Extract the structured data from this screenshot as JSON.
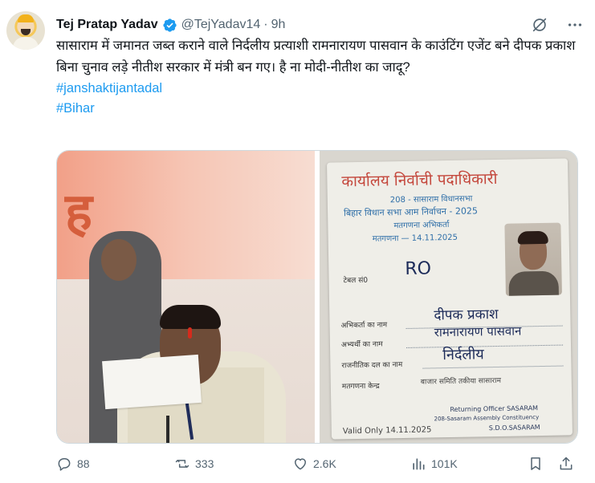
{
  "author": {
    "name": "Tej Pratap Yadav",
    "handle": "@TejYadav14",
    "separator": "·",
    "time": "9h"
  },
  "tweet": {
    "text": "सासाराम में जमानत जब्त कराने वाले निर्दलीय प्रत्याशी रामनारायण पासवान के काउंटिंग एजेंट बने दीपक प्रकाश बिना चुनाव लड़े नीतीश सरकार में मंत्री बन गए। है ना मोदी-नीतीश का जादू?",
    "hashtags": [
      "#janshaktijantadal",
      "#Bihar"
    ]
  },
  "media": {
    "left_banner_glyph": "ह",
    "card": {
      "title": "कार्यालय निर्वाची पदाधिकारी",
      "line1": "208 - सासाराम विधानसभा",
      "line2": "बिहार विधान सभा आम निर्वाचन - 2025",
      "line3": "मतगणना अभिकर्ता",
      "line4": "मतगणना — 14.11.2025",
      "table_label": "टेबल सं0",
      "table_value": "RO",
      "agent_label": "अभिकर्ता का नाम",
      "agent_value": "दीपक प्रकाश",
      "candidate_label": "अभ्यर्थी का नाम",
      "candidate_value": "रामनारायण पासवान",
      "party_label": "राजनीतिक दल का नाम",
      "party_value": "निर्दलीय",
      "centre_label": "मतगणना केन्द्र",
      "centre_value": "बाजार समिति तकीया सासाराम",
      "returning_officer": "Returning Officer SASARAM",
      "constituency": "208-Sasaram Assembly Constituency",
      "office": "S.D.O.SASARAM",
      "valid": "Valid Only 14.11.2025"
    }
  },
  "actions": {
    "replies": "88",
    "reposts": "333",
    "likes": "2.6K",
    "views": "101K"
  },
  "icons": {
    "verified": "verified-badge-icon",
    "grok": "grok-icon",
    "more": "more-icon",
    "reply": "reply-icon",
    "repost": "repost-icon",
    "like": "like-icon",
    "views": "views-icon",
    "bookmark": "bookmark-icon",
    "share": "share-icon"
  },
  "colors": {
    "accent": "#1d9bf0",
    "text": "#0f1419",
    "muted": "#536471"
  }
}
